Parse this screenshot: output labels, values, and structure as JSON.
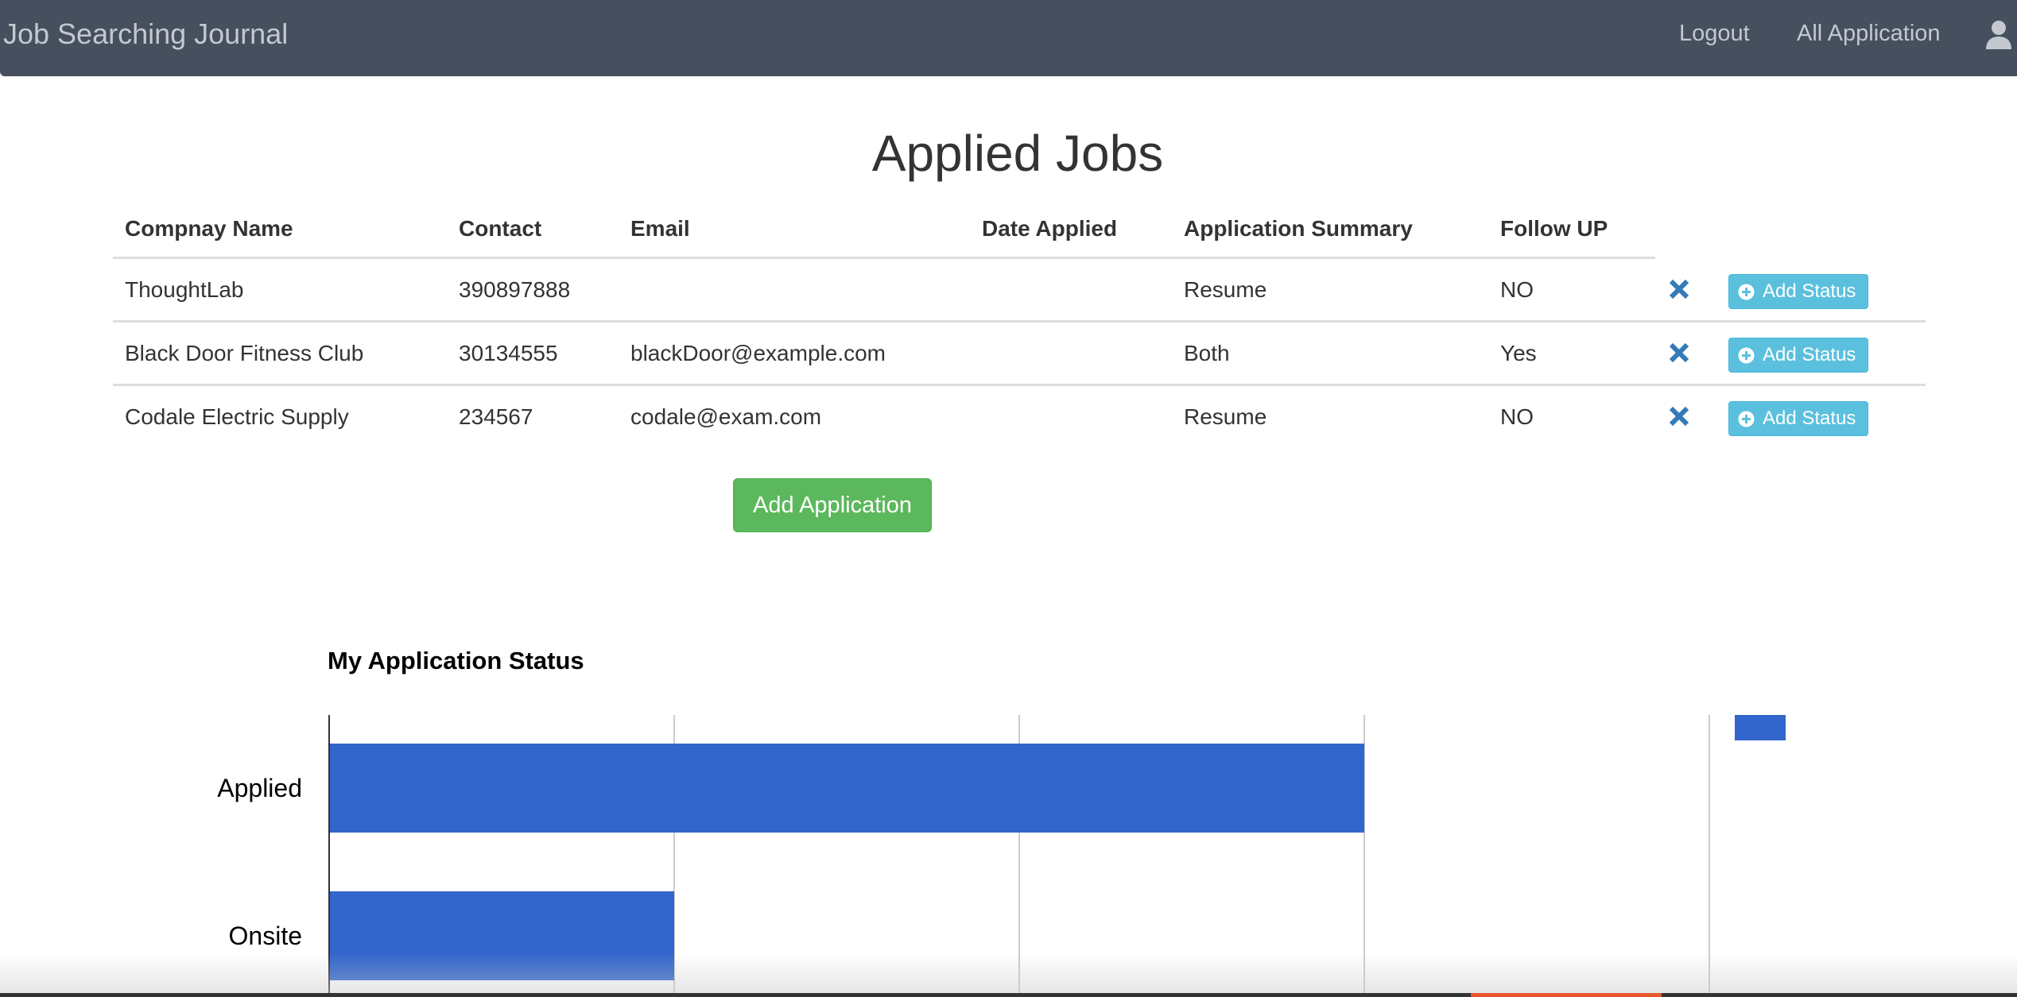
{
  "navbar": {
    "brand": "Job Searching Journal",
    "logout_label": "Logout",
    "all_application_label": "All Application",
    "user_icon": "user-icon"
  },
  "page_title": "Applied Jobs",
  "table": {
    "headers": [
      "Compnay Name",
      "Contact",
      "Email",
      "Date Applied",
      "Application Summary",
      "Follow UP"
    ],
    "rows": [
      {
        "company": "ThoughtLab",
        "contact": "390897888",
        "email": "",
        "date_applied": "",
        "summary": "Resume",
        "follow_up": "NO"
      },
      {
        "company": "Black Door Fitness Club",
        "contact": "30134555",
        "email": "blackDoor@example.com",
        "date_applied": "",
        "summary": "Both",
        "follow_up": "Yes"
      },
      {
        "company": "Codale Electric Supply",
        "contact": "234567",
        "email": "codale@exam.com",
        "date_applied": "",
        "summary": "Resume",
        "follow_up": "NO"
      }
    ],
    "add_status_label": "Add Status",
    "delete_icon": "close-icon",
    "add_status_icon": "plus-circle-icon"
  },
  "add_application_label": "Add Application",
  "chart_title": "My Application Status",
  "colors": {
    "navbar_bg": "#454f5e",
    "bar": "#3366cc",
    "info_button": "#5bc0de",
    "success_button": "#5cb85c",
    "delete_icon": "#337ab7"
  },
  "chart_data": {
    "type": "bar",
    "orientation": "horizontal",
    "title": "My Application Status",
    "categories": [
      "Applied",
      "Onsite"
    ],
    "values": [
      3,
      1
    ],
    "xlim": [
      0,
      4
    ],
    "grid": true,
    "legend": "top-right"
  }
}
